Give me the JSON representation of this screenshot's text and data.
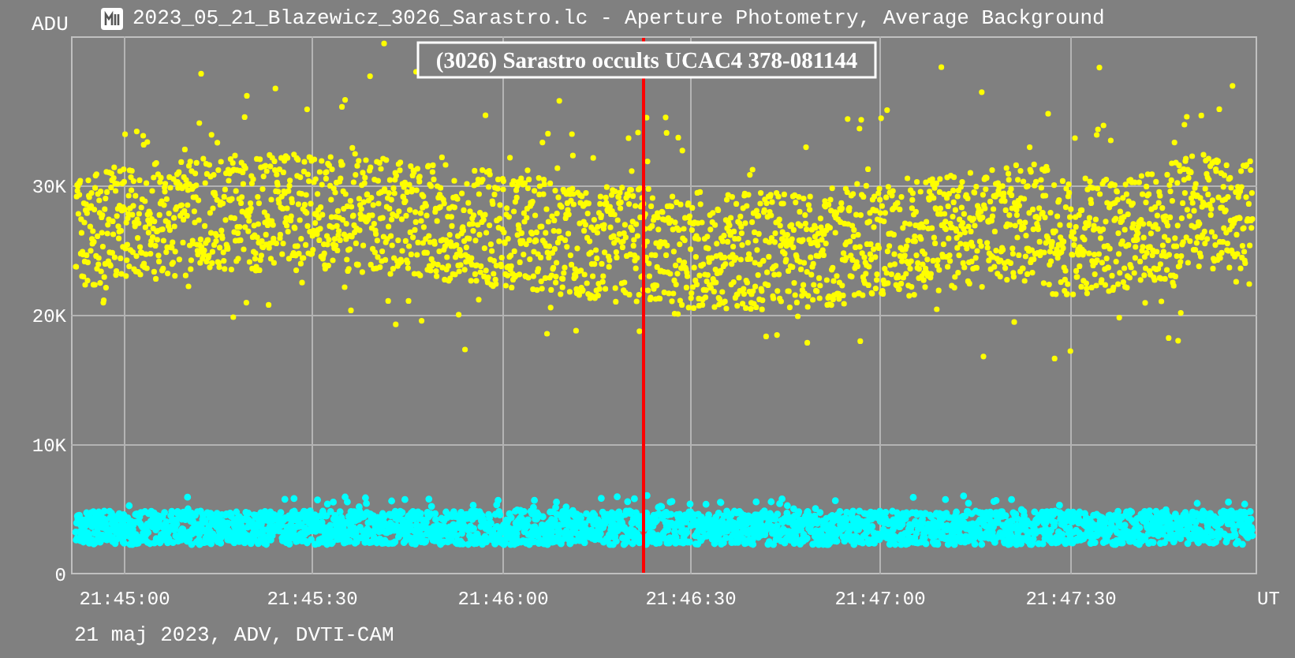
{
  "window": {
    "title": "2023_05_21_Blazewicz_3026_Sarastro.lc - Aperture Photometry, Average Background"
  },
  "chart": {
    "y_unit": "ADU",
    "x_unit": "UT",
    "annotation": "(3026) Sarastro occults UCAC4 378-081144",
    "yticks": [
      "30K",
      "20K",
      "10K",
      "0"
    ],
    "xticks": [
      "21:45:00",
      "21:45:30",
      "21:46:00",
      "21:46:30",
      "21:47:00",
      "21:47:30"
    ],
    "series": [
      {
        "color": "#ffff00"
      },
      {
        "color": "#00ffff"
      }
    ]
  },
  "footer": "21 maj 2023, ADV, DVTI-CAM"
}
